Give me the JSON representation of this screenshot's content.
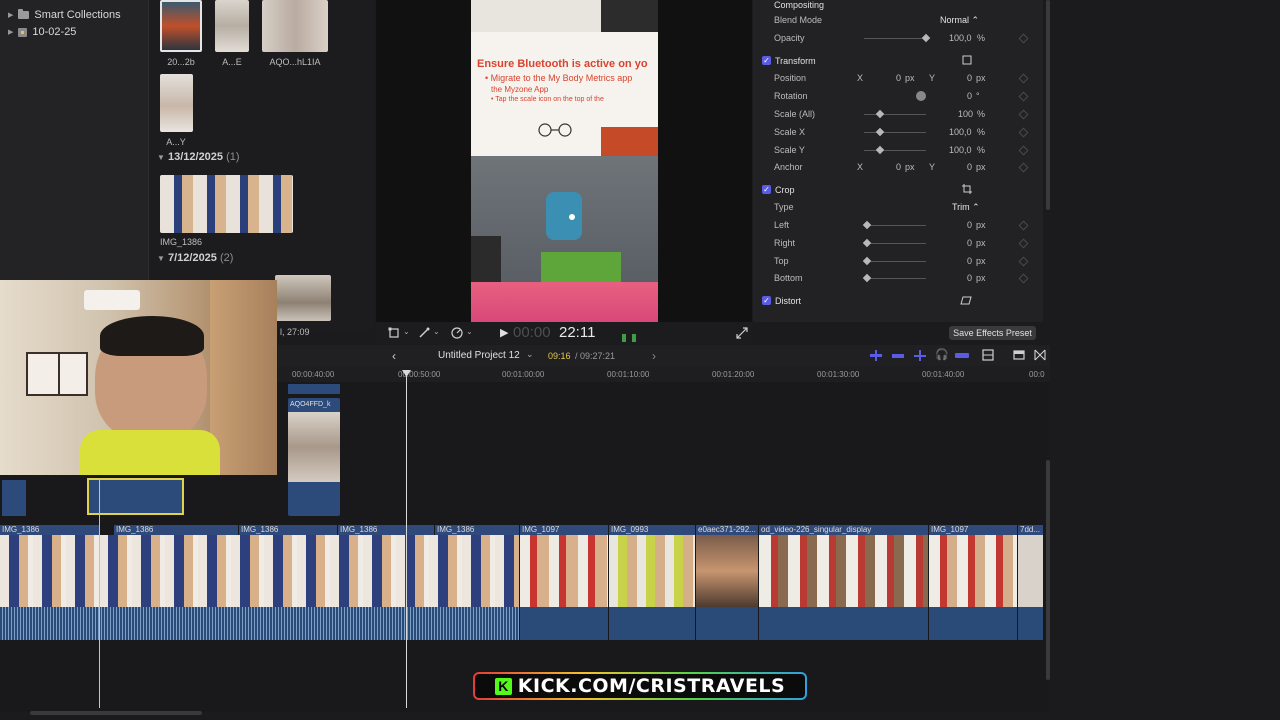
{
  "sidebar": {
    "items": [
      {
        "label": "Smart Collections"
      },
      {
        "label": "10-02-25"
      }
    ]
  },
  "browser": {
    "clips_row1": [
      {
        "label": "20...2b"
      },
      {
        "label": "A...E"
      },
      {
        "label": "AQO...hL1IA"
      }
    ],
    "clip_row2": {
      "label": "A...Y"
    },
    "groups": [
      {
        "date": "13/12/2025",
        "count": "(1)",
        "clip": "IMG_1386"
      },
      {
        "date": "7/12/2025",
        "count": "(2)"
      }
    ],
    "duration_fragment": "l, 27:09"
  },
  "viewer": {
    "sign_title": "Ensure Bluetooth is active on yo",
    "sign_bullet1": "• Migrate to the My Body Metrics app",
    "sign_line2": "the Myzone App",
    "sign_bullet2": "• Tap the scale icon on the top of the",
    "timecode_dim": "00:00",
    "timecode": "22:11"
  },
  "inspector": {
    "compositing": {
      "title": "Compositing",
      "blend_label": "Blend Mode",
      "blend_value": "Normal ⌃",
      "opacity_label": "Opacity",
      "opacity_value": "100,0",
      "opacity_unit": "%",
      "opacity_level": 1.0
    },
    "transform": {
      "title": "Transform",
      "position_label": "Position",
      "x_label": "X",
      "y_label": "Y",
      "pos_x": "0",
      "pos_y": "0",
      "px": "px",
      "rotation_label": "Rotation",
      "rotation_value": "0",
      "rotation_unit": "°",
      "scale_all_label": "Scale (All)",
      "scale_all_value": "100",
      "scale_x_label": "Scale X",
      "scale_x_value": "100,0",
      "scale_y_label": "Scale Y",
      "scale_y_value": "100,0",
      "pct": "%",
      "anchor_label": "Anchor",
      "anchor_x": "0",
      "anchor_y": "0"
    },
    "crop": {
      "title": "Crop",
      "type_label": "Type",
      "type_value": "Trim ⌃",
      "left_label": "Left",
      "right_label": "Right",
      "top_label": "Top",
      "bottom_label": "Bottom",
      "zero": "0",
      "px": "px"
    },
    "distort": {
      "title": "Distort"
    },
    "save_preset": "Save Effects Preset"
  },
  "timeline": {
    "project_name": "Untitled Project 12",
    "position": "09:16",
    "duration": "/ 09:27:21",
    "ruler_ticks": [
      "00:00:40:00",
      "00:00:50:00",
      "00:01:00:00",
      "00:01:10:00",
      "00:01:20:00",
      "00:01:30:00",
      "00:01:40:00",
      "00:0"
    ],
    "connected_clip": "AQO4FFD_k",
    "clips": [
      {
        "name": "IMG_1386"
      },
      {
        "name": "IMG_1386"
      },
      {
        "name": "IMG_1386"
      },
      {
        "name": "IMG_1386"
      },
      {
        "name": "IMG_1386"
      },
      {
        "name": "IMG_1097"
      },
      {
        "name": "IMG_0993"
      },
      {
        "name": "e0aec371-292..."
      },
      {
        "name": "od_video-226_singular_display"
      },
      {
        "name": "IMG_1097"
      },
      {
        "name": "7dd..."
      }
    ]
  },
  "banner": {
    "logo_letter": "K",
    "text": "KICK.COM/CRISTRAVELS"
  },
  "colors": {
    "accent": "#5b5ce6",
    "clip_label": "#2f4a7a",
    "audio": "#2a4b78",
    "kick_green": "#53fc18"
  }
}
